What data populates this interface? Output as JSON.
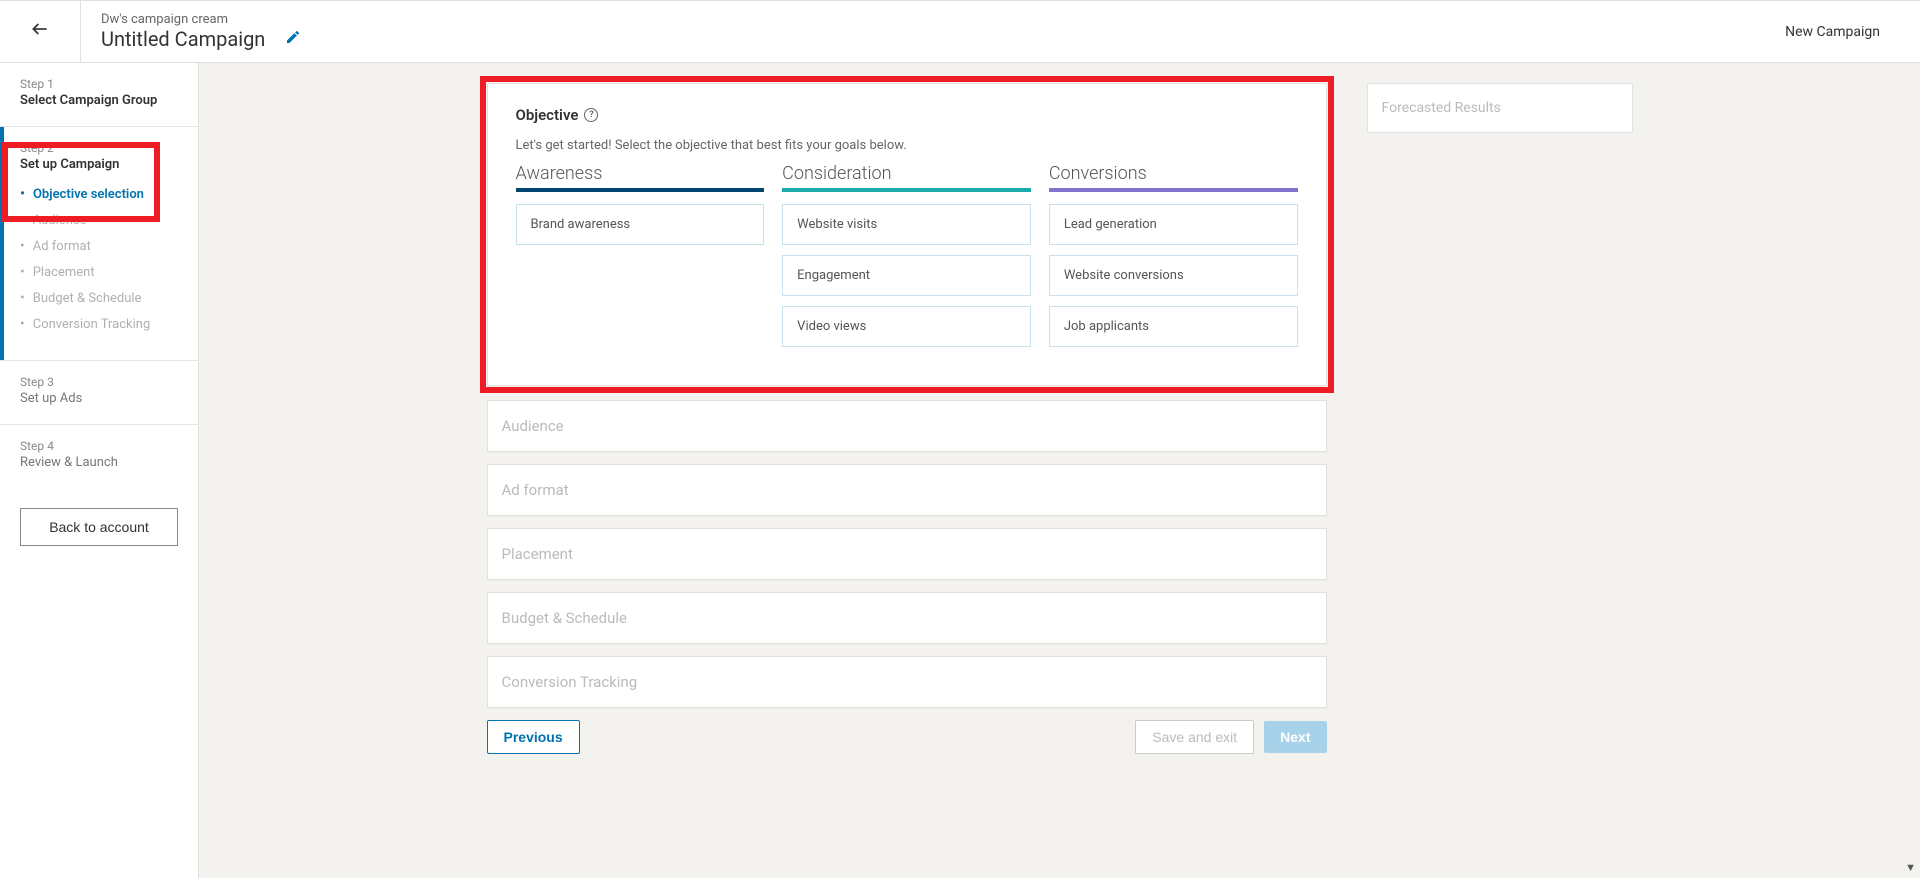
{
  "header": {
    "campaign_group": "Dw's campaign cream",
    "campaign_name": "Untitled Campaign",
    "new_campaign_label": "New Campaign"
  },
  "sidebar": {
    "step1": {
      "num": "Step 1",
      "title": "Select Campaign Group"
    },
    "step2": {
      "num": "Step 2",
      "title": "Set up Campaign",
      "subs": [
        "Objective selection",
        "Audience",
        "Ad format",
        "Placement",
        "Budget & Schedule",
        "Conversion Tracking"
      ]
    },
    "step3": {
      "num": "Step 3",
      "title": "Set up Ads"
    },
    "step4": {
      "num": "Step 4",
      "title": "Review & Launch"
    },
    "back_btn": "Back to account"
  },
  "objective": {
    "title": "Objective",
    "subtitle": "Let's get started! Select the objective that best fits your goals below.",
    "columns": {
      "awareness": {
        "title": "Awareness",
        "options": [
          "Brand awareness"
        ]
      },
      "consideration": {
        "title": "Consideration",
        "options": [
          "Website visits",
          "Engagement",
          "Video views"
        ]
      },
      "conversions": {
        "title": "Conversions",
        "options": [
          "Lead generation",
          "Website conversions",
          "Job applicants"
        ]
      }
    }
  },
  "sections": {
    "audience": "Audience",
    "ad_format": "Ad format",
    "placement": "Placement",
    "budget": "Budget & Schedule",
    "conversion": "Conversion Tracking"
  },
  "actions": {
    "previous": "Previous",
    "save_exit": "Save and exit",
    "next": "Next"
  },
  "forecast": {
    "title": "Forecasted Results"
  }
}
